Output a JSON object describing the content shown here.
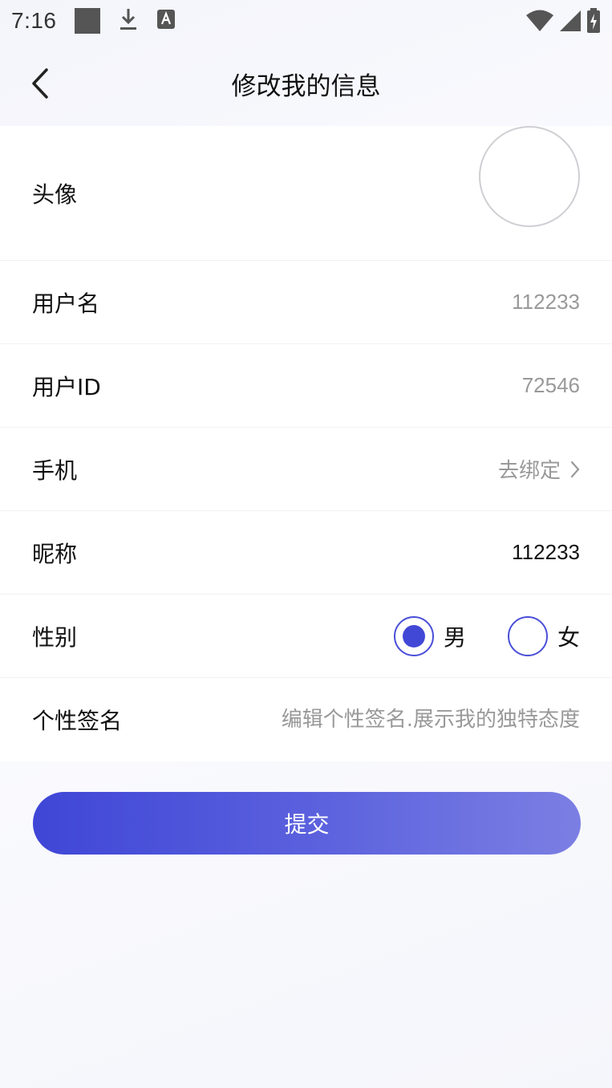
{
  "status_bar": {
    "time": "7:16",
    "icons": [
      "square-icon",
      "download-icon",
      "a-keyboard-icon"
    ],
    "right_icons": [
      "wifi-icon",
      "signal-icon",
      "battery-charging-icon"
    ]
  },
  "header": {
    "title": "修改我的信息",
    "back_icon": "chevron-left-icon"
  },
  "rows": {
    "avatar": {
      "label": "头像"
    },
    "username": {
      "label": "用户名",
      "value": "112233"
    },
    "user_id": {
      "label": "用户ID",
      "value": "72546"
    },
    "phone": {
      "label": "手机",
      "link": "去绑定"
    },
    "nickname": {
      "label": "昵称",
      "value": "112233"
    },
    "gender": {
      "label": "性别",
      "options": [
        {
          "label": "男",
          "selected": true
        },
        {
          "label": "女",
          "selected": false
        }
      ]
    },
    "signature": {
      "label": "个性签名",
      "placeholder": "编辑个性签名.展示我的独特态度",
      "value": ""
    }
  },
  "submit": {
    "label": "提交"
  },
  "colors": {
    "accent": "#4248d6",
    "accent_light": "#7b7fe3",
    "muted_text": "#999999"
  }
}
